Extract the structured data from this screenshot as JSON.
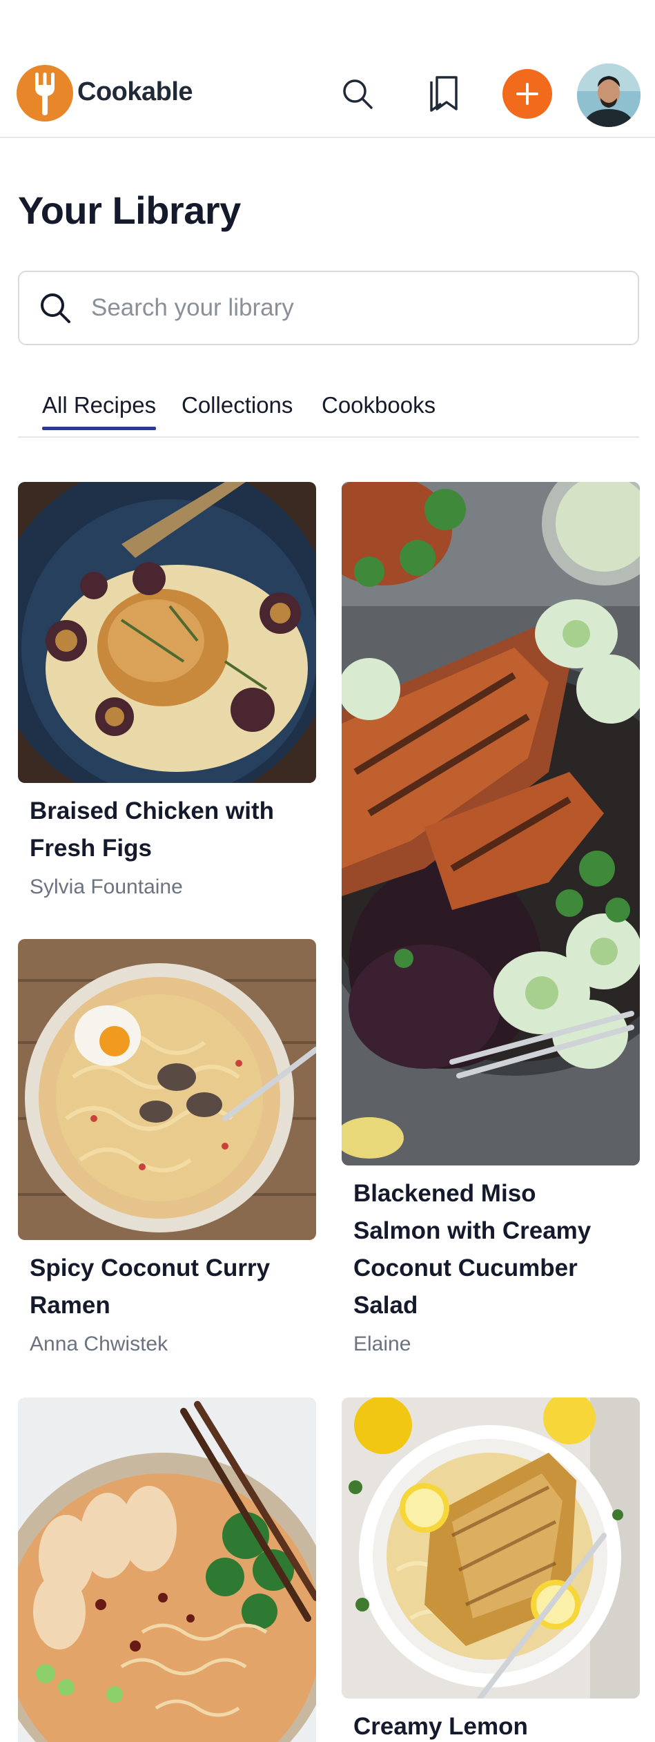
{
  "app": {
    "name": "Cookable",
    "colors": {
      "brand": "#e8862a",
      "add_button": "#f26b1d",
      "tab_underline": "#2b3a8f",
      "text": "#141a2b",
      "muted": "#6b7280"
    }
  },
  "header": {
    "icons": [
      "fork-logo-icon",
      "search-icon",
      "bookmarks-icon",
      "plus-icon",
      "avatar"
    ]
  },
  "page": {
    "title": "Your Library"
  },
  "search": {
    "placeholder": "Search your library",
    "value": ""
  },
  "tabs": [
    {
      "label": "All Recipes",
      "active": true
    },
    {
      "label": "Collections",
      "active": false
    },
    {
      "label": "Cookbooks",
      "active": false
    }
  ],
  "recipes": [
    {
      "title_line1": "Braised Chicken with",
      "title_line2": "Fresh Figs",
      "author": "Sylvia Fountaine"
    },
    {
      "title_line1": "Blackened Miso",
      "title_line2": "Salmon with Creamy",
      "title_line3": "Coconut Cucumber",
      "title_line4": "Salad",
      "author": "Elaine"
    },
    {
      "title_line1": "Spicy Coconut Curry",
      "title_line2": "Ramen",
      "author": "Anna Chwistek"
    },
    {
      "title_line1": "",
      "author": ""
    },
    {
      "title_line1": "Creamy Lemon",
      "author": ""
    }
  ]
}
